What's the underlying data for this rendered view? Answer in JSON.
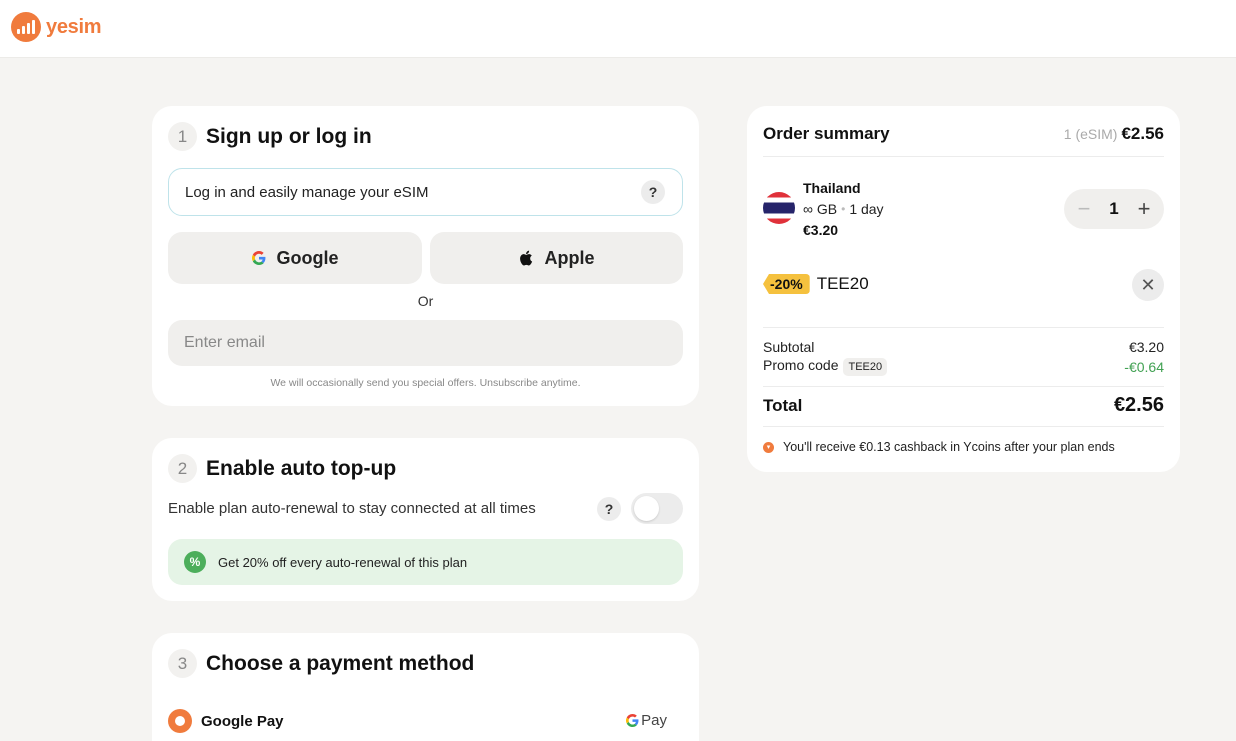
{
  "brand": {
    "name": "yesim",
    "color": "#f07b3d"
  },
  "step1": {
    "number": "1",
    "title": "Sign up or log in",
    "info": "Log in and easily manage your eSIM",
    "help": "?",
    "google_label": "Google",
    "apple_label": "Apple",
    "or": "Or",
    "email_placeholder": "Enter email",
    "fineprint": "We will occasionally send you special offers. Unsubscribe anytime."
  },
  "step2": {
    "number": "2",
    "title": "Enable auto top-up",
    "description": "Enable plan auto-renewal to stay connected at all times",
    "help": "?",
    "toggle_on": false,
    "promo_icon": "%",
    "promo_text": "Get 20% off every auto-renewal of this plan"
  },
  "step3": {
    "number": "3",
    "title": "Choose a payment method",
    "method_label": "Google Pay",
    "method_logo": "Pay"
  },
  "summary": {
    "title": "Order summary",
    "count": "1 (eSIM)",
    "amount": "€2.56",
    "item": {
      "country": "Thailand",
      "data": "∞ GB",
      "separator": "•",
      "duration": "1 day",
      "price": "€3.20",
      "quantity": "1",
      "minus": "−",
      "plus": "+"
    },
    "promo": {
      "discount": "-20%",
      "code": "TEE20",
      "remove": "✕"
    },
    "subtotal_label": "Subtotal",
    "subtotal_value": "€3.20",
    "promo_label": "Promo code",
    "promo_chip": "TEE20",
    "promo_value": "-€0.64",
    "total_label": "Total",
    "total_value": "€2.56",
    "cashback": "You'll receive €0.13 cashback in Ycoins after your plan ends"
  }
}
